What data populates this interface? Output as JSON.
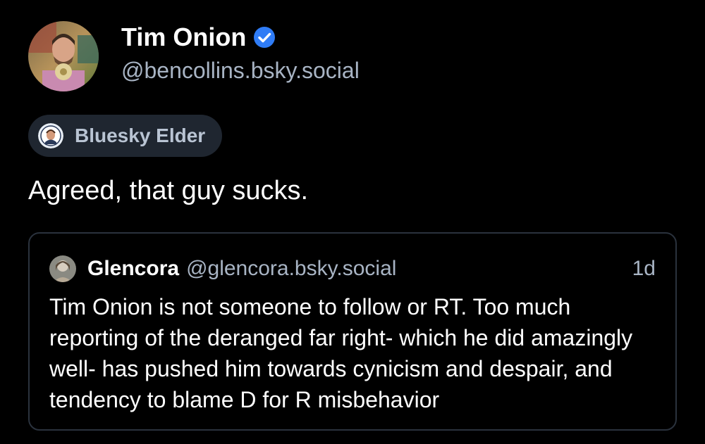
{
  "author": {
    "display_name": "Tim Onion",
    "handle": "@bencollins.bsky.social",
    "verified_icon": "verified-check-icon",
    "verified_color": "#2f7cf6"
  },
  "badge": {
    "label": "Bluesky Elder",
    "icon": "elder-badge-icon"
  },
  "post": {
    "text": "Agreed, that guy sucks."
  },
  "quote": {
    "display_name": "Glencora",
    "handle": "@glencora.bsky.social",
    "time": "1d",
    "text": "Tim Onion is not someone to follow or RT. Too much reporting of the deranged far right- which he did amazingly well- has pushed him towards cynicism and despair, and tendency to blame D for R misbehavior"
  },
  "colors": {
    "background": "#000000",
    "secondary_text": "#a8b4c4",
    "badge_bg": "#1f2630",
    "card_border": "#2a323d"
  }
}
